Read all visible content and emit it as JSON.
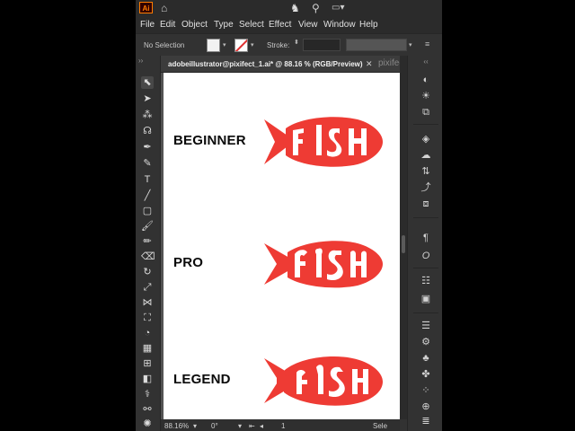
{
  "app": {
    "logo": "Ai",
    "colors": {
      "accent": "#ff7c00",
      "fish_red": "#ee3b34",
      "artboard": "#ffffff"
    }
  },
  "topbar": {
    "icons": [
      "home-icon",
      "share-icon",
      "search-icon",
      "window-arrange-icon"
    ]
  },
  "menu": {
    "items": [
      "File",
      "Edit",
      "Object",
      "Type",
      "Select",
      "Effect",
      "View",
      "Window",
      "Help"
    ]
  },
  "control_bar": {
    "selection": "No Selection",
    "stroke_label": "Stroke:"
  },
  "document": {
    "tab_title": "adobeillustrator@pixifect_1.ai* @ 88.16 % (RGB/Preview)",
    "watermark": "pixifect",
    "levels": [
      {
        "label": "BEGINNER"
      },
      {
        "label": "PRO"
      },
      {
        "label": "LEGEND"
      }
    ]
  },
  "status_bar": {
    "zoom": "88.16%",
    "rotation": "0°",
    "artboard_number": "1",
    "tool_hint": "Sele"
  }
}
